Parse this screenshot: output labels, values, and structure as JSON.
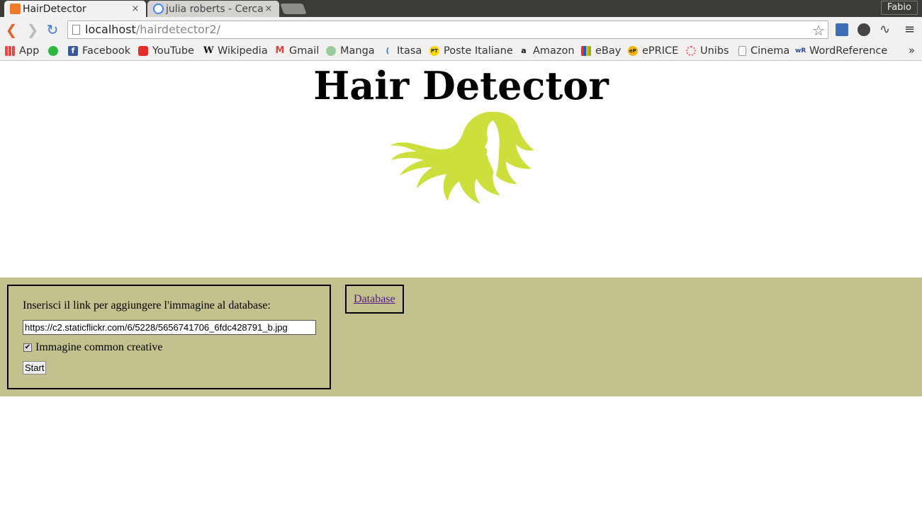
{
  "browser": {
    "tabs": [
      {
        "title": "HairDetector",
        "close": "×",
        "active": true
      },
      {
        "title": "julia roberts - Cerca c",
        "close": "×",
        "active": false
      }
    ],
    "profile_name": "Fabio",
    "url_host": "localhost",
    "url_path": "/hairdetector2/",
    "bookmarks": [
      {
        "label": "App",
        "icon": "apps-grid-icon"
      },
      {
        "label": "",
        "icon": "whatsapp-icon"
      },
      {
        "label": "Facebook",
        "icon": "facebook-icon"
      },
      {
        "label": "YouTube",
        "icon": "youtube-icon"
      },
      {
        "label": "Wikipedia",
        "icon": "wikipedia-icon"
      },
      {
        "label": "Gmail",
        "icon": "gmail-icon"
      },
      {
        "label": "Manga",
        "icon": "manga-icon"
      },
      {
        "label": "Itasa",
        "icon": "itasa-icon"
      },
      {
        "label": "Poste Italiane",
        "icon": "poste-icon"
      },
      {
        "label": "Amazon",
        "icon": "amazon-icon"
      },
      {
        "label": "eBay",
        "icon": "ebay-icon"
      },
      {
        "label": "ePRICE",
        "icon": "eprice-icon"
      },
      {
        "label": "Unibs",
        "icon": "unibs-icon"
      },
      {
        "label": "Cinema",
        "icon": "page-icon"
      },
      {
        "label": "WordReference",
        "icon": "wordreference-icon"
      }
    ],
    "bookmarks_overflow": "»"
  },
  "page": {
    "title": "Hair Detector",
    "form": {
      "prompt": "Inserisci il link per aggiungere l'immagine al database:",
      "link_value": "https://c2.staticflickr.com/6/5228/5656741706_6fdc428791_b.jpg",
      "checkbox_label": "Immagine common creative",
      "checkbox_checked": true,
      "start_label": "Start"
    },
    "database_link": "Database"
  },
  "colors": {
    "band": "#c3c28e",
    "logo": "#cddf3d",
    "link": "#551a8b"
  }
}
